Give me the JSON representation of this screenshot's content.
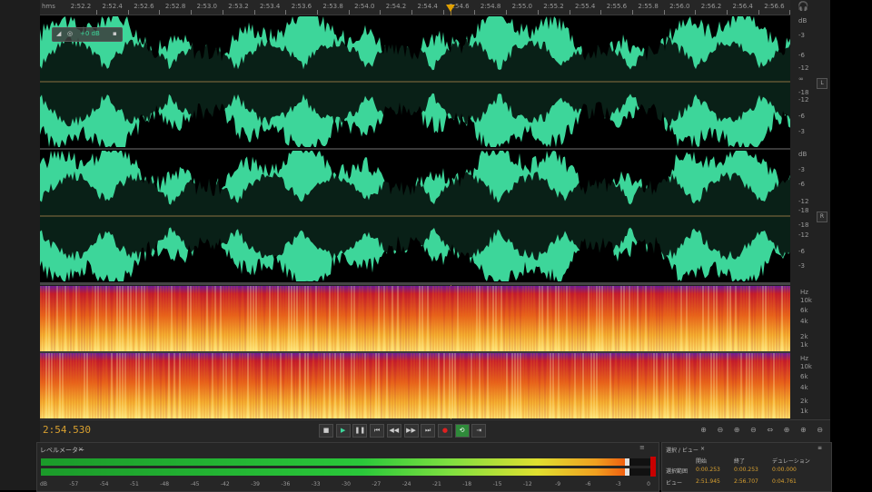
{
  "ruler": {
    "unit": "hms",
    "ticks": [
      "2:52.2",
      "2:52.4",
      "2:52.6",
      "2:52.8",
      "2:53.0",
      "2:53.2",
      "2:53.4",
      "2:53.6",
      "2:53.8",
      "2:54.0",
      "2:54.2",
      "2:54.4",
      "2:54.6",
      "2:54.8",
      "2:55.0",
      "2:55.2",
      "2:55.4",
      "2:55.6",
      "2:55.8",
      "2:56.0",
      "2:56.2",
      "2:56.4",
      "2:56.6"
    ]
  },
  "hud": {
    "gain": "+0 dB"
  },
  "db_scale": {
    "ch1": [
      "dB",
      "-3",
      "-6",
      "-12",
      "∞",
      "-18",
      "-12",
      "-6",
      "-3"
    ],
    "ch2": [
      "dB",
      "-3",
      "-6",
      "-12",
      "-18",
      "-18",
      "-12",
      "-6",
      "-3"
    ]
  },
  "channels": {
    "left": "L",
    "right": "R"
  },
  "hz_scale": {
    "ch1": [
      "Hz",
      "10k",
      "6k",
      "4k",
      "2k",
      "1k"
    ],
    "ch2": [
      "Hz",
      "10k",
      "6k",
      "4k",
      "2k",
      "1k"
    ]
  },
  "transport": {
    "timecode": "2:54.530",
    "buttons": [
      "■",
      "▶",
      "❚❚",
      "⏮",
      "◀◀",
      "▶▶",
      "⏭",
      "●",
      "⟲",
      "⇥"
    ]
  },
  "zoom": {
    "buttons": [
      "⊕",
      "⊖",
      "⊕",
      "⊖",
      "⇔",
      "⊕",
      "⊕",
      "⊖"
    ]
  },
  "levels_panel": {
    "title": "レベルメーター",
    "level_fraction": 0.957,
    "scale": [
      "dB",
      "-57",
      "-54",
      "-51",
      "-48",
      "-45",
      "-42",
      "-39",
      "-36",
      "-33",
      "-30",
      "-27",
      "-24",
      "-21",
      "-18",
      "-15",
      "-12",
      "-9",
      "-6",
      "-3",
      "0"
    ]
  },
  "selection_panel": {
    "title": "選択 / ビュー",
    "col_start": "開始",
    "col_end": "終了",
    "col_duration": "デュレーション",
    "row_selection": "選択範囲",
    "row_view": "ビュー",
    "sel_start": "0:00.253",
    "sel_end": "0:00.253",
    "sel_duration": "0:00.000",
    "view_start": "2:51.945",
    "view_end": "2:56.707",
    "view_duration": "0:04.761"
  },
  "colors": {
    "waveform": "#3dd69a",
    "timecode": "#d8a030"
  }
}
